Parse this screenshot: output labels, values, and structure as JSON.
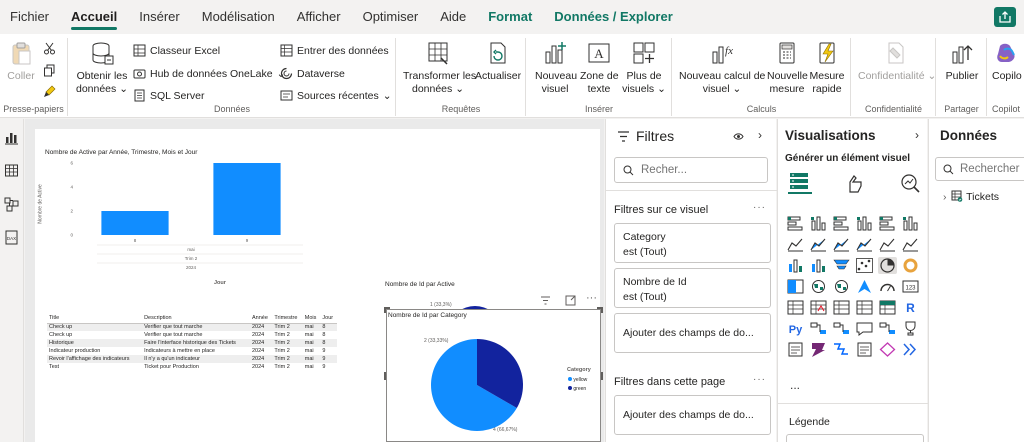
{
  "menu": {
    "items": [
      "Fichier",
      "Accueil",
      "Insérer",
      "Modélisation",
      "Afficher",
      "Optimiser",
      "Aide"
    ],
    "context_items": [
      "Format",
      "Données / Explorer"
    ],
    "active": "Accueil"
  },
  "ribbon": {
    "clipboard": {
      "coller": "Coller",
      "group": "Presse-papiers"
    },
    "data": {
      "obtenir_1": "Obtenir les",
      "obtenir_2": "données",
      "excel": "Classeur Excel",
      "onelake": "Hub de données OneLake",
      "sql": "SQL Server",
      "entrer": "Entrer des données",
      "dataverse": "Dataverse",
      "sources": "Sources récentes",
      "group": "Données"
    },
    "queries": {
      "transformer_1": "Transformer les",
      "transformer_2": "données",
      "actualiser": "Actualiser",
      "group": "Requêtes"
    },
    "insert": {
      "nouveau_1": "Nouveau",
      "nouveau_2": "visuel",
      "zone_1": "Zone de",
      "zone_2": "texte",
      "plus_1": "Plus de",
      "plus_2": "visuels",
      "group": "Insérer"
    },
    "calc": {
      "calcul_1": "Nouveau calcul de",
      "calcul_2": "visuel",
      "mesure_1": "Nouvelle",
      "mesure_2": "mesure",
      "rapide_1": "Mesure",
      "rapide_2": "rapide",
      "group": "Calculs"
    },
    "sensitivity": {
      "label": "Confidentialité",
      "group": "Confidentialité"
    },
    "share": {
      "publier": "Publier",
      "group": "Partager"
    },
    "copilot": {
      "label": "Copilo",
      "group": "Copilot"
    }
  },
  "bar_chart": {
    "title": "Nombre de Active par Année, Trimestre, Mois et Jour",
    "ylabel": "Nombre de Active",
    "xlabel": "Jour",
    "yticks": [
      "0",
      "2",
      "4",
      "6"
    ],
    "day_labels": [
      "8",
      "9"
    ],
    "month_label": "mai",
    "quarter_label": "Trim 2",
    "year_label": "2024",
    "color": "#118dff"
  },
  "chart_data": [
    {
      "type": "bar",
      "categories": [
        "8",
        "9"
      ],
      "values": [
        2,
        6
      ],
      "title": "Nombre de Active par Année, Trimestre, Mois et Jour",
      "xlabel": "Jour",
      "ylabel": "Nombre de Active",
      "ylim": [
        0,
        6
      ]
    },
    {
      "type": "pie",
      "title": "Nombre de Id par Category",
      "categories": [
        "yellow",
        "green"
      ],
      "values": [
        4,
        2
      ],
      "percent_labels": [
        "4 (66,67%)",
        "2 (33,33%)"
      ],
      "legend_title": "Category",
      "legend": "right"
    }
  ],
  "table": {
    "headers": [
      "Title",
      "Description",
      "Année",
      "Trimestre",
      "Mois",
      "Jour"
    ],
    "rows": [
      [
        "Check up",
        "Verifier que tout marche",
        "2024",
        "Trim 2",
        "mai",
        "8"
      ],
      [
        "Check up",
        "Verifier que tout marche",
        "2024",
        "Trim 2",
        "mai",
        "8"
      ],
      [
        "Historique",
        "Faire l'interface historique des Tickets",
        "2024",
        "Trim 2",
        "mai",
        "8"
      ],
      [
        "Indicateur production",
        "Indicateurs à mettre en place",
        "2024",
        "Trim 2",
        "mai",
        "9"
      ],
      [
        "Revoir l'affichage des indicateurs",
        "Il n'y a qu'un indicateur",
        "2024",
        "Trim 2",
        "mai",
        "9"
      ],
      [
        "Test",
        "Ticket pour Production",
        "2024",
        "Trim 2",
        "mai",
        "9"
      ]
    ]
  },
  "pie_back": {
    "title": "Nombre de Id par Active",
    "top_label": "1 (33,3%)"
  },
  "pie": {
    "title": "Nombre de Id par Category",
    "label_small": "2 (33,33%)",
    "label_large": "4 (66,67%)",
    "legend_title": "Category",
    "legend": [
      {
        "name": "yellow",
        "color": "#118dff"
      },
      {
        "name": "green",
        "color": "#12239e"
      }
    ]
  },
  "filters": {
    "title": "Filtres",
    "search_placeholder": "Recher...",
    "on_visual": "Filtres sur ce visuel",
    "card1_field": "Category",
    "card1_value": "est (Tout)",
    "card2_field": "Nombre de Id",
    "card2_value": "est (Tout)",
    "add_fields": "Ajouter des champs de do...",
    "on_page": "Filtres dans cette page",
    "add_fields_page": "Ajouter des champs de do..."
  },
  "visualizations": {
    "title": "Visualisations",
    "subtitle": "Générer un élément visuel",
    "legend": "Légende",
    "more": "..."
  },
  "data_pane": {
    "title": "Données",
    "search_placeholder": "Rechercher",
    "tables": [
      "Tickets"
    ]
  }
}
